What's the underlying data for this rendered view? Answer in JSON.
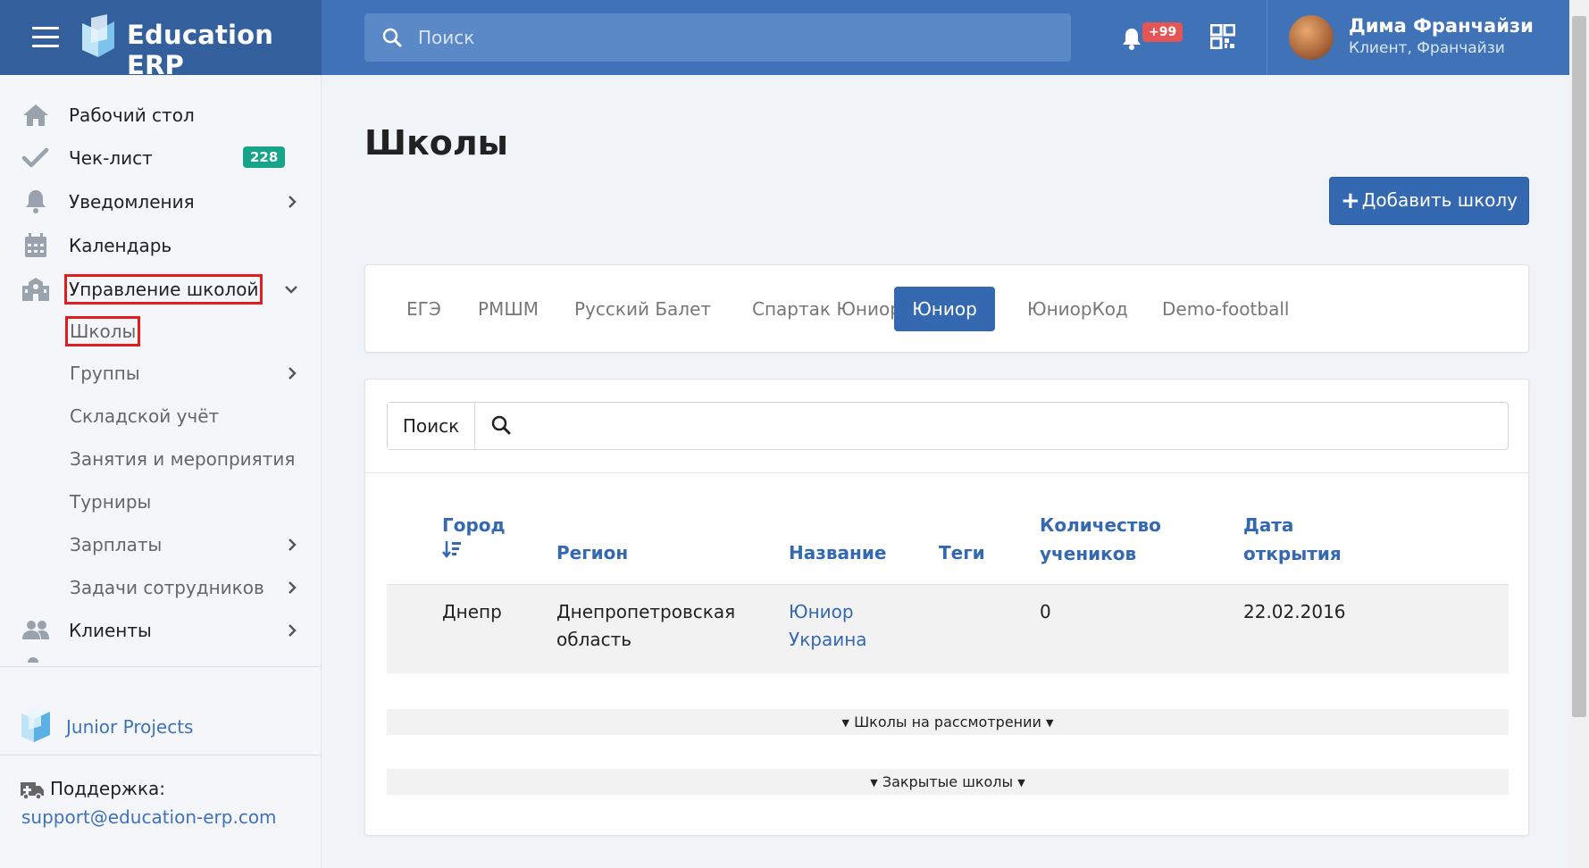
{
  "app": {
    "brand_name": "Education ERP",
    "search_placeholder": "Поиск",
    "notifications_badge": "+99",
    "user": {
      "name": "Дима Франчайзи",
      "role": "Клиент, Франчайзи"
    }
  },
  "sidebar": {
    "items": [
      {
        "label": "Рабочий стол",
        "icon": "home-icon"
      },
      {
        "label": "Чек-лист",
        "icon": "check-icon",
        "badge": "228"
      },
      {
        "label": "Уведомления",
        "icon": "bell-icon"
      },
      {
        "label": "Календарь",
        "icon": "calendar-icon"
      },
      {
        "label": "Управление школой",
        "icon": "school-icon"
      },
      {
        "label": "Клиенты",
        "icon": "users-icon"
      }
    ],
    "subitems": [
      {
        "label": "Школы"
      },
      {
        "label": "Группы"
      },
      {
        "label": "Складской учёт"
      },
      {
        "label": "Занятия и мероприятия"
      },
      {
        "label": "Турниры"
      },
      {
        "label": "Зарплаты"
      },
      {
        "label": "Задачи сотрудников"
      }
    ],
    "project_name": "Junior Projects",
    "support_label": "Поддержка:",
    "support_email": "support@education-erp.com"
  },
  "main": {
    "title": "Школы",
    "add_button": "Добавить школу",
    "tabs": [
      {
        "label": "ЕГЭ",
        "active": false
      },
      {
        "label": "РМШМ",
        "active": false
      },
      {
        "label": "Русский Балет",
        "active": false
      },
      {
        "label": "Спартак Юниор",
        "active": false
      },
      {
        "label": "Юниор",
        "active": true
      },
      {
        "label": "ЮниорКод",
        "active": false
      },
      {
        "label": "Demo-football",
        "active": false
      }
    ],
    "search_label": "Поиск",
    "table": {
      "headers": {
        "city": "Город",
        "region": "Регион",
        "name": "Название",
        "tags": "Теги",
        "students_1": "Количество",
        "students_2": "учеников",
        "opened_1": "Дата",
        "opened_2": "открытия"
      },
      "rows": [
        {
          "city": "Днепр",
          "region_1": "Днепропетровская",
          "region_2": "область",
          "name_1": "Юниор",
          "name_2": "Украина",
          "tags": "",
          "students": "0",
          "opened": "22.02.2016"
        }
      ]
    },
    "pending_schools": "Школы на рассмотрении",
    "closed_schools": "Закрытые школы"
  },
  "colors": {
    "header": "#3f72b7",
    "brand_bg": "#335f9d",
    "primary": "#3468b0",
    "badge_green": "#17a589",
    "badge_red": "#e45656"
  }
}
